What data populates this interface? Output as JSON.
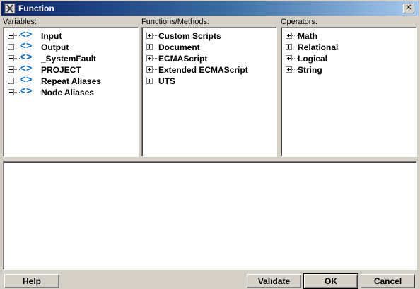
{
  "window": {
    "title": "Function",
    "close_glyph": "✕"
  },
  "panels": {
    "variables": {
      "label": "Variables:",
      "items": [
        {
          "label": "Input",
          "icon": "variable-icon"
        },
        {
          "label": "Output",
          "icon": "variable-icon"
        },
        {
          "label": "_SystemFault",
          "icon": "variable-icon"
        },
        {
          "label": "PROJECT",
          "icon": "variable-icon"
        },
        {
          "label": "Repeat Aliases",
          "icon": "variable-icon"
        },
        {
          "label": "Node Aliases",
          "icon": "variable-icon"
        }
      ]
    },
    "functions": {
      "label": "Functions/Methods:",
      "items": [
        {
          "label": "Custom Scripts"
        },
        {
          "label": "Document"
        },
        {
          "label": "ECMAScript"
        },
        {
          "label": "Extended ECMAScript"
        },
        {
          "label": "UTS"
        }
      ]
    },
    "operators": {
      "label": "Operators:",
      "items": [
        {
          "label": "Math"
        },
        {
          "label": "Relational"
        },
        {
          "label": "Logical"
        },
        {
          "label": "String"
        }
      ]
    }
  },
  "editor": {
    "value": ""
  },
  "buttons": {
    "help": "Help",
    "validate": "Validate",
    "ok": "OK",
    "cancel": "Cancel"
  },
  "colors": {
    "title_bar_start": "#0a246a",
    "title_bar_end": "#a6caf0",
    "variable_icon": "#0066cc"
  }
}
